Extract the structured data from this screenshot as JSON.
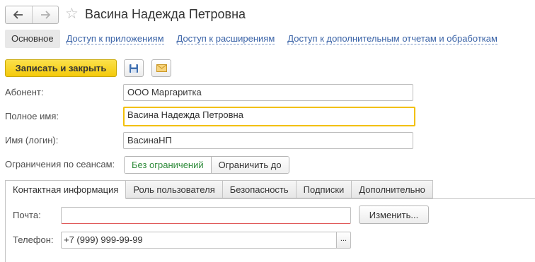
{
  "header": {
    "title": "Васина Надежда Петровна",
    "back_icon": "arrow-left",
    "forward_icon": "arrow-right",
    "favorite_icon": "star-outline"
  },
  "link_tabs": [
    {
      "label": "Основное",
      "active": true
    },
    {
      "label": "Доступ к приложениям",
      "active": false
    },
    {
      "label": "Доступ к расширениям",
      "active": false
    },
    {
      "label": "Доступ к дополнительным отчетам и обработкам",
      "active": false
    }
  ],
  "toolbar": {
    "save_close_label": "Записать и закрыть",
    "save_icon": "floppy-disk",
    "email_icon": "envelope",
    "accent_color": "#f4ca0b"
  },
  "form": {
    "subscriber_label": "Абонент:",
    "subscriber_value": "ООО Маргаритка",
    "full_name_label": "Полное имя:",
    "full_name_value": "Васина Надежда Петровна",
    "login_label": "Имя (логин):",
    "login_value": "ВасинаНП",
    "sessions_label": "Ограничения по сеансам:",
    "sessions_no_limit": "Без ограничений",
    "sessions_limit_until": "Ограничить до"
  },
  "tabs": [
    {
      "label": "Контактная информация",
      "active": true
    },
    {
      "label": "Роль пользователя",
      "active": false
    },
    {
      "label": "Безопасность",
      "active": false
    },
    {
      "label": "Подписки",
      "active": false
    },
    {
      "label": "Дополнительно",
      "active": false
    }
  ],
  "contact": {
    "email_label": "Почта:",
    "email_value": "",
    "change_button": "Изменить...",
    "phone_label": "Телефон:",
    "phone_value": "+7 (999) 999-99-99",
    "phone_button": "..."
  }
}
